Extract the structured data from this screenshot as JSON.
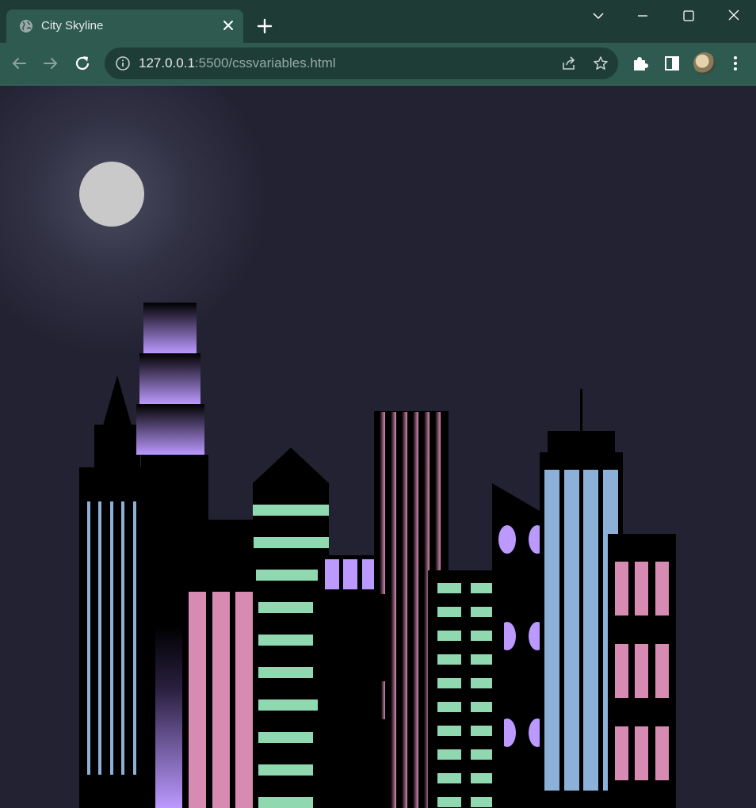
{
  "browser": {
    "tab_title": "City Skyline",
    "url_host": "127.0.0.1",
    "url_rest": ":5500/cssvariables.html"
  },
  "colors": {
    "chrome_frame": "#1f3b35",
    "chrome_toolbar": "#2e5a4f",
    "sky": "#232233",
    "moon": "#c9c9c9",
    "building": "#000000",
    "window_blue": "#8cb0d8",
    "window_pink": "#d78ab2",
    "window_green": "#8fd8b0",
    "window_purple": "#bb99ff"
  },
  "icons": {
    "tab_favicon": "globe-icon",
    "tab_close": "close-icon",
    "new_tab": "plus-icon",
    "tab_search": "chevron-down-icon",
    "minimize": "minimize-icon",
    "maximize": "maximize-icon",
    "close_window": "close-icon",
    "back": "arrow-left-icon",
    "forward": "arrow-right-icon",
    "reload": "reload-icon",
    "site_info": "info-icon",
    "share": "share-icon",
    "bookmark": "star-icon",
    "extensions": "puzzle-icon",
    "side_panel": "side-panel-icon",
    "profile": "avatar",
    "menu": "kebab-menu-icon"
  }
}
